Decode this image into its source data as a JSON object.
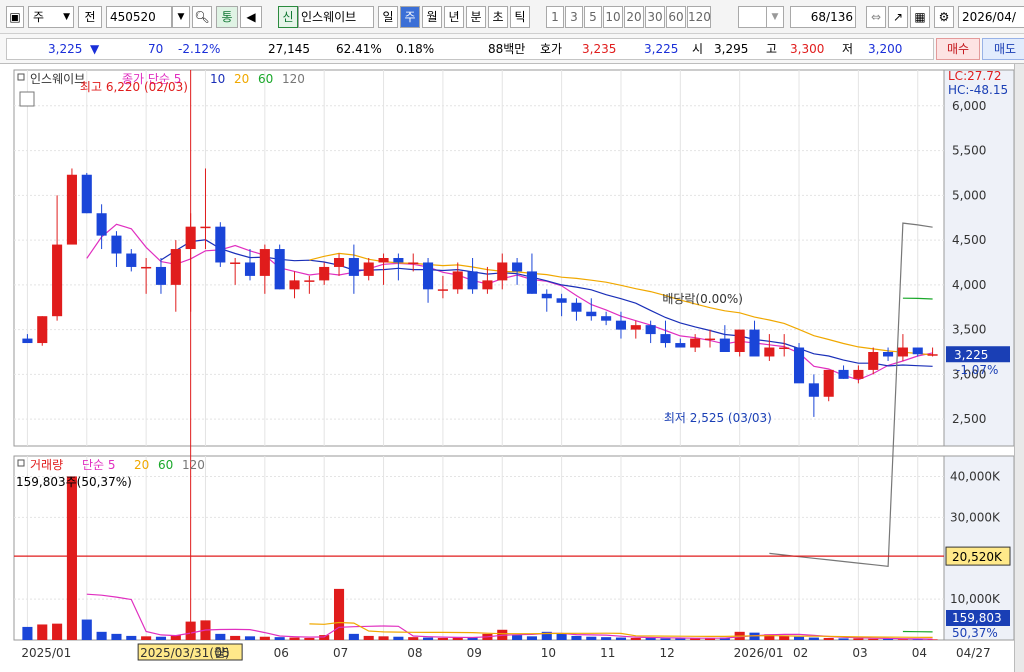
{
  "toolbar": {
    "mode_label": "주",
    "label_jeon": "전",
    "code_value": "450520",
    "label_tong": "통",
    "label_sin": "신",
    "stock_name": "인스웨이브",
    "periods": [
      "일",
      "주",
      "월",
      "년",
      "분",
      "초",
      "틱"
    ],
    "active_period": "주",
    "numbers": [
      "1",
      "3",
      "5",
      "10",
      "20",
      "30",
      "60",
      "120"
    ],
    "count": "68",
    "count_total": "/136",
    "date": "2026/04/"
  },
  "quote": {
    "price": "3,225",
    "arrow": "▼",
    "change": "70",
    "change_pct": "-2.12%",
    "volume": "27,145",
    "volume_ratio": "62.41%",
    "turnover": "0.18%",
    "amount": "88백만",
    "hoga_label": "호가",
    "ask": "3,235",
    "bid": "3,225",
    "open_label": "시",
    "open": "3,295",
    "high_label": "고",
    "high": "3,300",
    "low_label": "저",
    "low": "3,200",
    "buy_label": "매수",
    "sell_label": "매도"
  },
  "price_panel": {
    "stock_tag": "인스웨이브",
    "ma_label": "종가 단순 5",
    "ma_periods": [
      "10",
      "20",
      "60",
      "120"
    ],
    "lc": "LC:27.72",
    "hc": "HC:-48.15",
    "high_marker": "최고 6,220 (02/03)",
    "low_marker": "최저 2,525 (03/03)",
    "dividend_label": "배당락(0.00%)",
    "current_price_tag": "3,225",
    "current_change_tag": "-1.07%"
  },
  "volume_panel": {
    "label": "거래량",
    "ma_label": "단순 5",
    "ma_periods": [
      "20",
      "60",
      "120"
    ],
    "current_volume": "159,803주(50,37%)",
    "line_tag": "20,520K",
    "vol_tag": "159,803",
    "pct_tag": "50,37%"
  },
  "x_axis": {
    "labels": [
      "2025/01",
      "2025/03/31(월)",
      "05",
      "06",
      "07",
      "08",
      "09",
      "10",
      "11",
      "12",
      "2026/01",
      "02",
      "03",
      "04",
      "04/27"
    ]
  },
  "colors": {
    "up": "#e01c1c",
    "down": "#1a45d8",
    "ma5": "#e02fc0",
    "ma10": "#1a2fb8",
    "ma20": "#f0a800",
    "ma60": "#1aa82a",
    "ma120": "#777777"
  },
  "chart_data": {
    "type": "candlestick",
    "weeks": 62,
    "ohlc": [
      [
        3400,
        3450,
        3380,
        3350
      ],
      [
        3350,
        3650,
        3320,
        3650
      ],
      [
        3650,
        5000,
        3600,
        4450
      ],
      [
        4450,
        5300,
        4500,
        5230
      ],
      [
        5230,
        5250,
        4800,
        4800
      ],
      [
        4800,
        4900,
        4400,
        4550
      ],
      [
        4550,
        4600,
        4200,
        4350
      ],
      [
        4350,
        4400,
        4150,
        4200
      ],
      [
        4200,
        4300,
        3900,
        4200
      ],
      [
        4200,
        4300,
        3900,
        4000
      ],
      [
        4000,
        4500,
        3700,
        4400
      ],
      [
        4400,
        4800,
        3700,
        4650
      ],
      [
        4650,
        5300,
        4400,
        4650
      ],
      [
        4650,
        4700,
        4200,
        4250
      ],
      [
        4250,
        4300,
        4000,
        4250
      ],
      [
        4250,
        4400,
        4050,
        4100
      ],
      [
        4100,
        4450,
        3900,
        4400
      ],
      [
        4400,
        4450,
        3950,
        3950
      ],
      [
        3950,
        4150,
        3850,
        4050
      ],
      [
        4050,
        4100,
        3900,
        4050
      ],
      [
        4050,
        4250,
        4000,
        4200
      ],
      [
        4200,
        4350,
        4100,
        4300
      ],
      [
        4300,
        4450,
        3900,
        4100
      ],
      [
        4100,
        4300,
        4050,
        4250
      ],
      [
        4250,
        4350,
        4000,
        4300
      ],
      [
        4300,
        4350,
        4050,
        4250
      ],
      [
        4250,
        4350,
        4150,
        4250
      ],
      [
        4250,
        4300,
        3800,
        3950
      ],
      [
        3950,
        4100,
        3850,
        3950
      ],
      [
        3950,
        4250,
        3900,
        4150
      ],
      [
        4150,
        4300,
        3900,
        3950
      ],
      [
        3950,
        4200,
        3900,
        4050
      ],
      [
        4050,
        4350,
        3950,
        4250
      ],
      [
        4250,
        4300,
        4000,
        4150
      ],
      [
        4150,
        4350,
        3900,
        3900
      ],
      [
        3900,
        3950,
        3700,
        3850
      ],
      [
        3850,
        3900,
        3650,
        3800
      ],
      [
        3800,
        3850,
        3600,
        3700
      ],
      [
        3700,
        3850,
        3600,
        3650
      ],
      [
        3650,
        3700,
        3550,
        3600
      ],
      [
        3600,
        3700,
        3400,
        3500
      ],
      [
        3500,
        3600,
        3400,
        3550
      ],
      [
        3550,
        3600,
        3350,
        3450
      ],
      [
        3450,
        3600,
        3300,
        3350
      ],
      [
        3350,
        3400,
        3300,
        3300
      ],
      [
        3300,
        3450,
        3250,
        3400
      ],
      [
        3400,
        3500,
        3300,
        3400
      ],
      [
        3400,
        3550,
        3350,
        3250
      ],
      [
        3250,
        3500,
        3200,
        3500
      ],
      [
        3500,
        3600,
        3300,
        3200
      ],
      [
        3200,
        3450,
        3150,
        3300
      ],
      [
        3300,
        3450,
        3200,
        3300
      ],
      [
        3300,
        3350,
        2950,
        2900
      ],
      [
        2900,
        3000,
        2525,
        2750
      ],
      [
        2750,
        3050,
        2700,
        3050
      ],
      [
        3050,
        3100,
        2950,
        2950
      ],
      [
        2950,
        3100,
        2900,
        3050
      ],
      [
        3050,
        3300,
        3000,
        3250
      ],
      [
        3250,
        3300,
        3150,
        3200
      ],
      [
        3200,
        3450,
        3150,
        3300
      ],
      [
        3300,
        3300,
        3200,
        3225
      ],
      [
        3225,
        3300,
        3200,
        3225
      ]
    ],
    "volume_k": [
      3200,
      3800,
      4000,
      40000,
      5000,
      2000,
      1500,
      1000,
      900,
      800,
      1200,
      4500,
      4800,
      1500,
      1000,
      900,
      800,
      700,
      600,
      500,
      1200,
      12500,
      1500,
      1000,
      900,
      800,
      700,
      600,
      500,
      600,
      700,
      1500,
      2500,
      1200,
      900,
      2000,
      1500,
      1000,
      800,
      700,
      600,
      500,
      500,
      400,
      400,
      400,
      500,
      600,
      2000,
      1800,
      1400,
      1000,
      800,
      600,
      500,
      400,
      400,
      300,
      300,
      200,
      159,
      160
    ],
    "price_ylim": [
      2200,
      6400
    ],
    "volume_ylim": [
      0,
      45000
    ],
    "price_ticks": [
      "6,000",
      "5,500",
      "5,000",
      "4,500",
      "4,000",
      "3,500",
      "3,000",
      "2,500"
    ],
    "volume_ticks": [
      "40,000K",
      "30,000K",
      "10,000K"
    ]
  }
}
